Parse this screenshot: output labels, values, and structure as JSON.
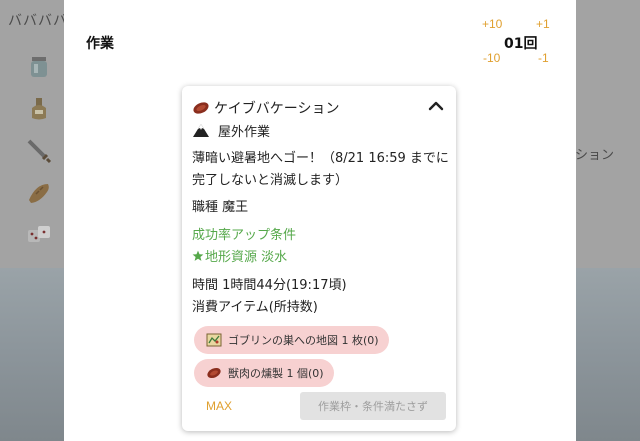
{
  "background": {
    "strip_text": "ババババ",
    "side_text": "ション",
    "icons": [
      "jar-icon",
      "potion-icon",
      "sword-icon",
      "bread-icon",
      "dice-icon"
    ]
  },
  "work_panel": {
    "title": "作業",
    "count": "01回",
    "plus_ten": "+10",
    "plus_one": "+1",
    "minus_ten": "-10",
    "minus_one": "-1"
  },
  "quest": {
    "title": "ケイブバケーション",
    "type": "屋外作業",
    "description": "薄暗い避暑地へゴー！（8/21 16:59 までに完了しないと消滅します）",
    "job": "職種 魔王",
    "bonus_heading": "成功率アップ条件",
    "bonus_item": "地形資源 淡水",
    "time": "時間 1時間44分(19:17頃)",
    "consume_heading": "消費アイテム(所持数)",
    "items": [
      {
        "label": "ゴブリンの巣への地図 1 枚(0)",
        "icon": "map-icon"
      },
      {
        "label": "獣肉の燻製 1 個(0)",
        "icon": "meat-icon"
      }
    ],
    "max_label": "MAX",
    "submit_label": "作業枠・条件満たさず"
  },
  "colors": {
    "accent_orange": "#e0a030",
    "bonus_green": "#55a84a",
    "item_chip_bg": "#f7d1d1",
    "disabled_button_bg": "#e2e2e2"
  }
}
